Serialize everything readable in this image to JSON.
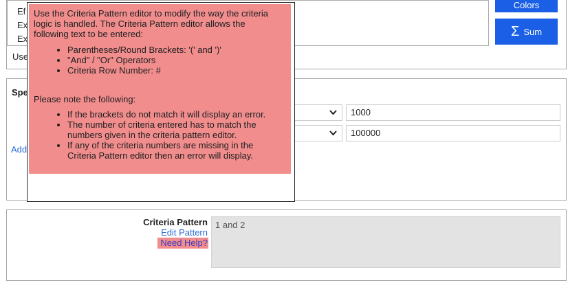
{
  "top": {
    "list_items": [
      "Ef",
      "Ex",
      "Ex"
    ],
    "caption": "Use",
    "colors_button": "Colors",
    "sum_button": "Sum"
  },
  "middle": {
    "title": "Spe",
    "add_link": "Add",
    "rows": [
      {
        "value": "1000"
      },
      {
        "value": "100000"
      }
    ]
  },
  "bottom": {
    "criteria_pattern_label": "Criteria Pattern",
    "edit_pattern_link": "Edit Pattern",
    "need_help_link": "Need Help?",
    "pattern_value": "1 and 2"
  },
  "tooltip": {
    "intro": "Use the Criteria Pattern editor to modify the way the criteria logic is handled. The Criteria Pattern editor allows the following text to be entered:",
    "allowed": [
      "Parentheses/Round Brackets: '(' and ')'",
      "\"And\" / \"Or\" Operators",
      "Criteria Row Number: #"
    ],
    "note_heading": "Please note the following:",
    "notes": [
      "If the brackets do not match it will display an error.",
      "The number of criteria entered has to match the numbers given in the criteria pattern editor.",
      "If any of the criteria numbers are missing in the Criteria Pattern editor then an error will display."
    ]
  },
  "colors": {
    "accent": "#1a5fe6",
    "tooltip_bg": "#f18d8d",
    "link": "#2a6bd6"
  }
}
